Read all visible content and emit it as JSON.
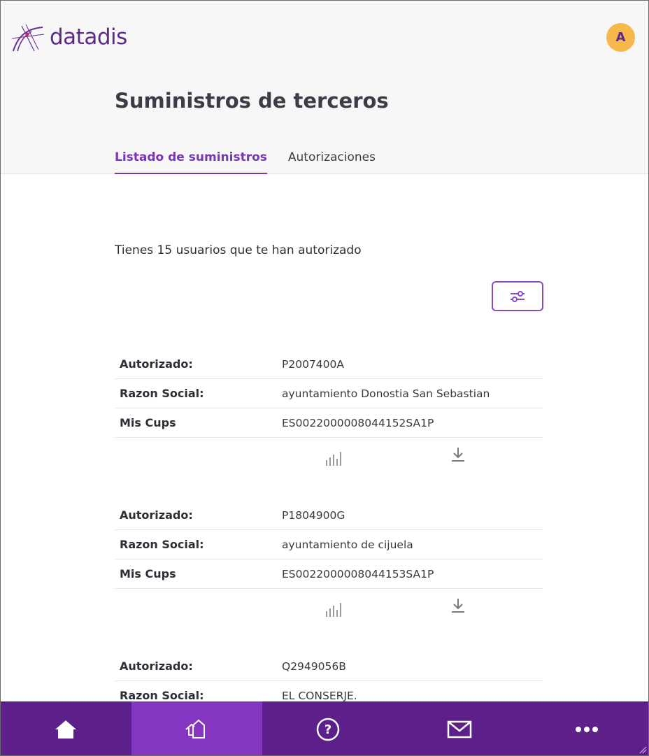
{
  "brand": {
    "name": "datadis",
    "accent": "#7a34b8",
    "nav_bg": "#5d1f8a",
    "nav_active_bg": "#8436c0",
    "avatar_bg": "#f7b84b"
  },
  "header": {
    "avatar_initial": "A"
  },
  "page": {
    "title": "Suministros de terceros",
    "tabs": [
      {
        "label": "Listado de suministros",
        "active": true
      },
      {
        "label": "Autorizaciones",
        "active": false
      }
    ],
    "count_text": "Tienes 15 usuarios que te han autorizado",
    "filter_icon": "sliders-icon"
  },
  "labels": {
    "autorizado": "Autorizado:",
    "razon": "Razon Social:",
    "cups": "Mis Cups"
  },
  "suministros": [
    {
      "autorizado": "P2007400A",
      "razon": "ayuntamiento Donostia San Sebastian",
      "cups": "ES0022000008044152SA1P"
    },
    {
      "autorizado": "P1804900G",
      "razon": "ayuntamiento de cijuela",
      "cups": "ES0022000008044153SA1P"
    },
    {
      "autorizado": "Q2949056B",
      "razon": "EL CONSERJE."
    }
  ],
  "bottom_nav": [
    {
      "icon": "home-icon",
      "active": false
    },
    {
      "icon": "supplies-icon",
      "active": true
    },
    {
      "icon": "help-icon",
      "active": false
    },
    {
      "icon": "mail-icon",
      "active": false
    },
    {
      "icon": "more-icon",
      "active": false
    }
  ]
}
